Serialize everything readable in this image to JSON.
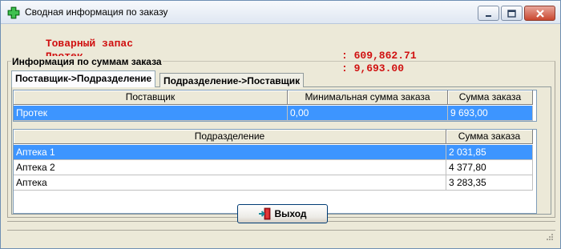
{
  "window": {
    "title": "Сводная информация по заказу",
    "icon": "green-cross-icon"
  },
  "summary": {
    "stock_label": "Товарный запас",
    "stock_value": ": 609,862.71",
    "supplier_label": "Протек",
    "supplier_value": ": 9,693.00"
  },
  "group": {
    "legend": "Информация по суммам заказа"
  },
  "tabs": [
    {
      "label": "Поставщик->Подразделение",
      "active": true
    },
    {
      "label": "Подразделение->Поставщик",
      "active": false
    }
  ],
  "supplier_table": {
    "headers": [
      "Поставщик",
      "Минимальная сумма заказа",
      "Сумма заказа"
    ],
    "rows": [
      {
        "cells": [
          "Протек",
          "0,00",
          "9 693,00"
        ],
        "selected": true
      }
    ]
  },
  "department_table": {
    "headers": [
      "Подразделение",
      "Сумма заказа"
    ],
    "rows": [
      {
        "cells": [
          "Аптека 1",
          "2 031,85"
        ],
        "selected": true
      },
      {
        "cells": [
          "Аптека 2",
          "4 377,80"
        ],
        "selected": false
      },
      {
        "cells": [
          "Аптека",
          "3 283,35"
        ],
        "selected": false
      }
    ]
  },
  "buttons": {
    "exit_label": "Выход",
    "exit_icon": "exit-door-icon"
  },
  "colors": {
    "summary_text": "#d01010",
    "selection": "#3d95ff"
  }
}
